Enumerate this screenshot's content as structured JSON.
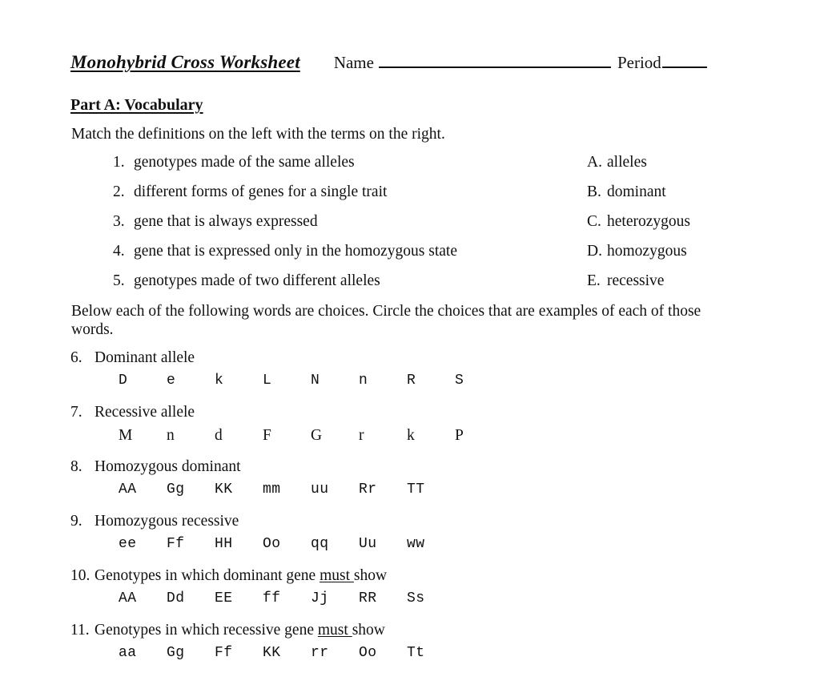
{
  "header": {
    "title": "Monohybrid Cross Worksheet",
    "name_label": "Name",
    "period_label": "Period"
  },
  "part_a": {
    "heading": "Part A:  Vocabulary",
    "match_instruction": "Match the definitions on the left with the terms on the right.",
    "definitions": [
      {
        "num": "1.",
        "text": "genotypes made of the same alleles"
      },
      {
        "num": "2.",
        "text": "different forms of genes for a single trait"
      },
      {
        "num": "3.",
        "text": "gene that is always expressed"
      },
      {
        "num": "4.",
        "text": "gene that is expressed only in the homozygous state"
      },
      {
        "num": "5.",
        "text": "genotypes made of two different alleles"
      }
    ],
    "terms": [
      {
        "letter": "A.",
        "text": "alleles"
      },
      {
        "letter": "B.",
        "text": "dominant"
      },
      {
        "letter": "C.",
        "text": "heterozygous"
      },
      {
        "letter": "D.",
        "text": "homozygous"
      },
      {
        "letter": "E.",
        "text": "recessive"
      }
    ],
    "circle_instruction": "Below each of the following words are choices.  Circle the choices that are examples of each of  those words.",
    "word_items": [
      {
        "num": "6.",
        "label": "Dominant allele",
        "label_underline_word": "",
        "font": "mono",
        "choices": [
          "D",
          "e",
          "k",
          "L",
          "N",
          "n",
          "R",
          "S"
        ]
      },
      {
        "num": "7.",
        "label": "Recessive allele",
        "label_underline_word": "",
        "font": "serif",
        "choices": [
          "M",
          "n",
          "d",
          "F",
          "G",
          "r",
          "k",
          "P"
        ]
      },
      {
        "num": "8.",
        "label": "Homozygous dominant",
        "label_underline_word": "",
        "font": "mono",
        "choices": [
          "AA",
          "Gg",
          "KK",
          "mm",
          "uu",
          "Rr",
          "TT"
        ]
      },
      {
        "num": "9.",
        "label": "Homozygous recessive",
        "label_underline_word": "",
        "font": "mono",
        "choices": [
          "ee",
          "Ff",
          "HH",
          "Oo",
          "qq",
          "Uu",
          "ww"
        ]
      },
      {
        "num": "10.",
        "label_before": "Genotypes in which dominant gene ",
        "label_underline_word": "must",
        "label_after": " show",
        "font": "mono",
        "choices": [
          "AA",
          "Dd",
          "EE",
          "ff",
          "Jj",
          "RR",
          "Ss"
        ]
      },
      {
        "num": "11.",
        "label_before": "Genotypes in which recessive gene ",
        "label_underline_word": "must",
        "label_after": " show",
        "font": "mono",
        "choices": [
          "aa",
          "Gg",
          "Ff",
          "KK",
          "rr",
          "Oo",
          "Tt"
        ]
      }
    ]
  }
}
